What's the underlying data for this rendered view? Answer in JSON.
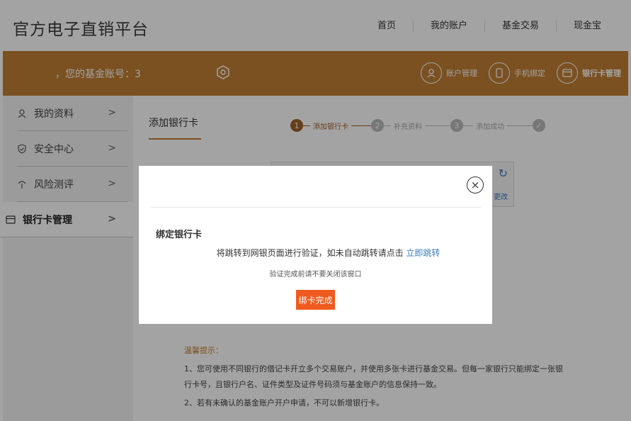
{
  "site": {
    "title": "官方电子直销平台"
  },
  "topnav": [
    {
      "label": "首页"
    },
    {
      "label": "我的账户"
    },
    {
      "label": "基金交易"
    },
    {
      "label": "现金宝"
    }
  ],
  "account_bar": {
    "label": "，您的基金账号：3",
    "links": [
      {
        "label": "账户管理",
        "icon": "user-icon"
      },
      {
        "label": "手机绑定",
        "icon": "phone-icon"
      },
      {
        "label": "银行卡管理",
        "icon": "card-icon"
      }
    ]
  },
  "sidebar": {
    "items": [
      {
        "label": "我的资料",
        "icon": "user-icon"
      },
      {
        "label": "安全中心",
        "icon": "shield-icon"
      },
      {
        "label": "风险测评",
        "icon": "risk-icon"
      },
      {
        "label": "银行卡管理",
        "icon": "card-icon"
      }
    ],
    "chevron": ">"
  },
  "main": {
    "tab": "添加银行卡",
    "steps": [
      {
        "num": "1",
        "label": "添加银行卡"
      },
      {
        "num": "2",
        "label": "补充资料"
      },
      {
        "num": "3",
        "label": "添加成功"
      }
    ],
    "card_modify": "更改"
  },
  "tips": {
    "title": "温馨提示：",
    "items": [
      "1、您可使用不同银行的借记卡开立多个交易账户，并使用多张卡进行基金交易。但每一家银行只能绑定一张银行卡号，且银行户名、证件类型及证件号码须与基金账户的信息保持一致。",
      "2、若有未确认的基金账户开户申请，不可以新增银行卡。"
    ]
  },
  "modal": {
    "title": "绑定银行卡",
    "message": "将跳转到网银页面进行验证，如未自动跳转请点击",
    "link": "立即跳转",
    "sub": "验证完成前请不要关闭该窗口",
    "button": "绑卡完成",
    "close": "×"
  },
  "colors": {
    "brand": "#c07f35",
    "link": "#3b7bbf",
    "button": "#f05a1e"
  }
}
